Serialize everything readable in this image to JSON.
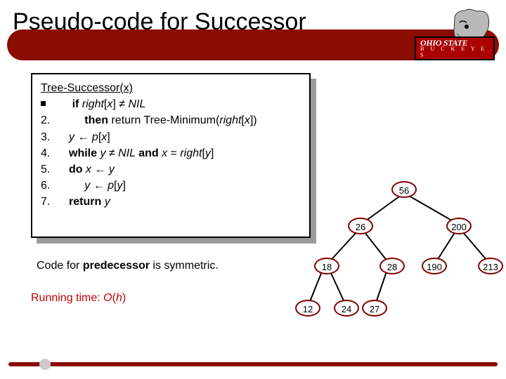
{
  "title": "Pseudo-code for Successor",
  "logo": {
    "top": "OHIO STATE",
    "bottom": "B U C K E Y E S"
  },
  "code": {
    "fn": "Tree-Successor(x)",
    "l1a": "if ",
    "l1b": "right",
    "l1c": "[",
    "l1d": "x",
    "l1e": "] ≠ ",
    "l1f": "NIL",
    "l2a": "2.",
    "l2b": "then ",
    "l2c": "return Tree-Minimum(",
    "l2d": "right",
    "l2e": "[",
    "l2f": "x",
    "l2g": "])",
    "l3a": "3.",
    "l3b": "y",
    "l3c": " ← ",
    "l3d": "p",
    "l3e": "[",
    "l3f": "x",
    "l3g": "]",
    "l4a": "4.",
    "l4b": "while ",
    "l4c": "y",
    "l4d": " ≠ ",
    "l4e": "NIL ",
    "l4f": "and ",
    "l4g": "x",
    "l4h": " = ",
    "l4i": "right",
    "l4j": "[",
    "l4k": "y",
    "l4l": "]",
    "l5a": "5.",
    "l5b": "do ",
    "l5c": "x",
    "l5d": " ← ",
    "l5e": "y",
    "l6a": "6.",
    "l6b": "y",
    "l6c": " ← ",
    "l6d": "p",
    "l6e": "[",
    "l6f": "y",
    "l6g": "]",
    "l7a": "7.",
    "l7b": "return ",
    "l7c": "y"
  },
  "notes": {
    "p1a": "Code for ",
    "p1b": "predecessor",
    "p1c": " is symmetric.",
    "p2a": "Running time: ",
    "p2b": "O",
    "p2c": "(",
    "p2d": "h",
    "p2e": ")"
  },
  "tree": {
    "n56": "56",
    "n26": "26",
    "n200": "200",
    "n18": "18",
    "n28": "28",
    "n190": "190",
    "n213": "213",
    "n12": "12",
    "n24": "24",
    "n27": "27"
  }
}
